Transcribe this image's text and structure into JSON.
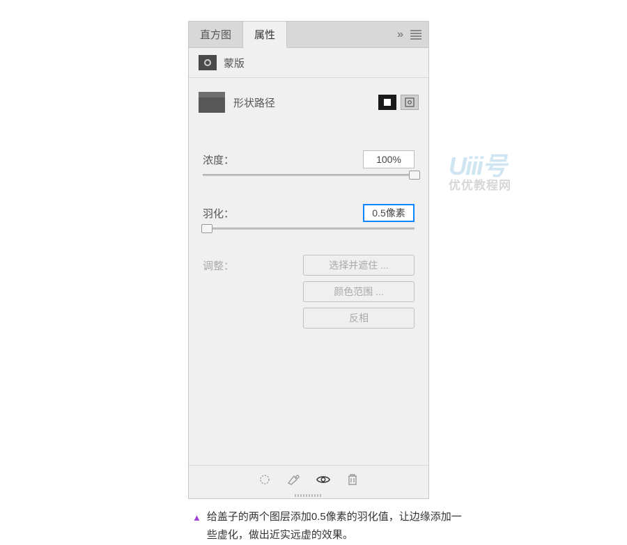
{
  "tabs": {
    "histogram": "直方图",
    "properties": "属性"
  },
  "section": {
    "mask_label": "蒙版"
  },
  "shape": {
    "label": "形状路径"
  },
  "density": {
    "label": "浓度：",
    "value": "100%"
  },
  "feather": {
    "label": "羽化：",
    "value": "0.5像素"
  },
  "adjust": {
    "label": "调整：",
    "buttons": {
      "select_mask": "选择并遮住 ...",
      "color_range": "颜色范围 ...",
      "invert": "反相"
    }
  },
  "watermark": {
    "logo": "Uiii号",
    "sub": "优优教程网"
  },
  "caption": {
    "marker": "▲",
    "text": "给盖子的两个图层添加0.5像素的羽化值，让边缘添加一些虚化，做出近实远虚的效果。"
  }
}
